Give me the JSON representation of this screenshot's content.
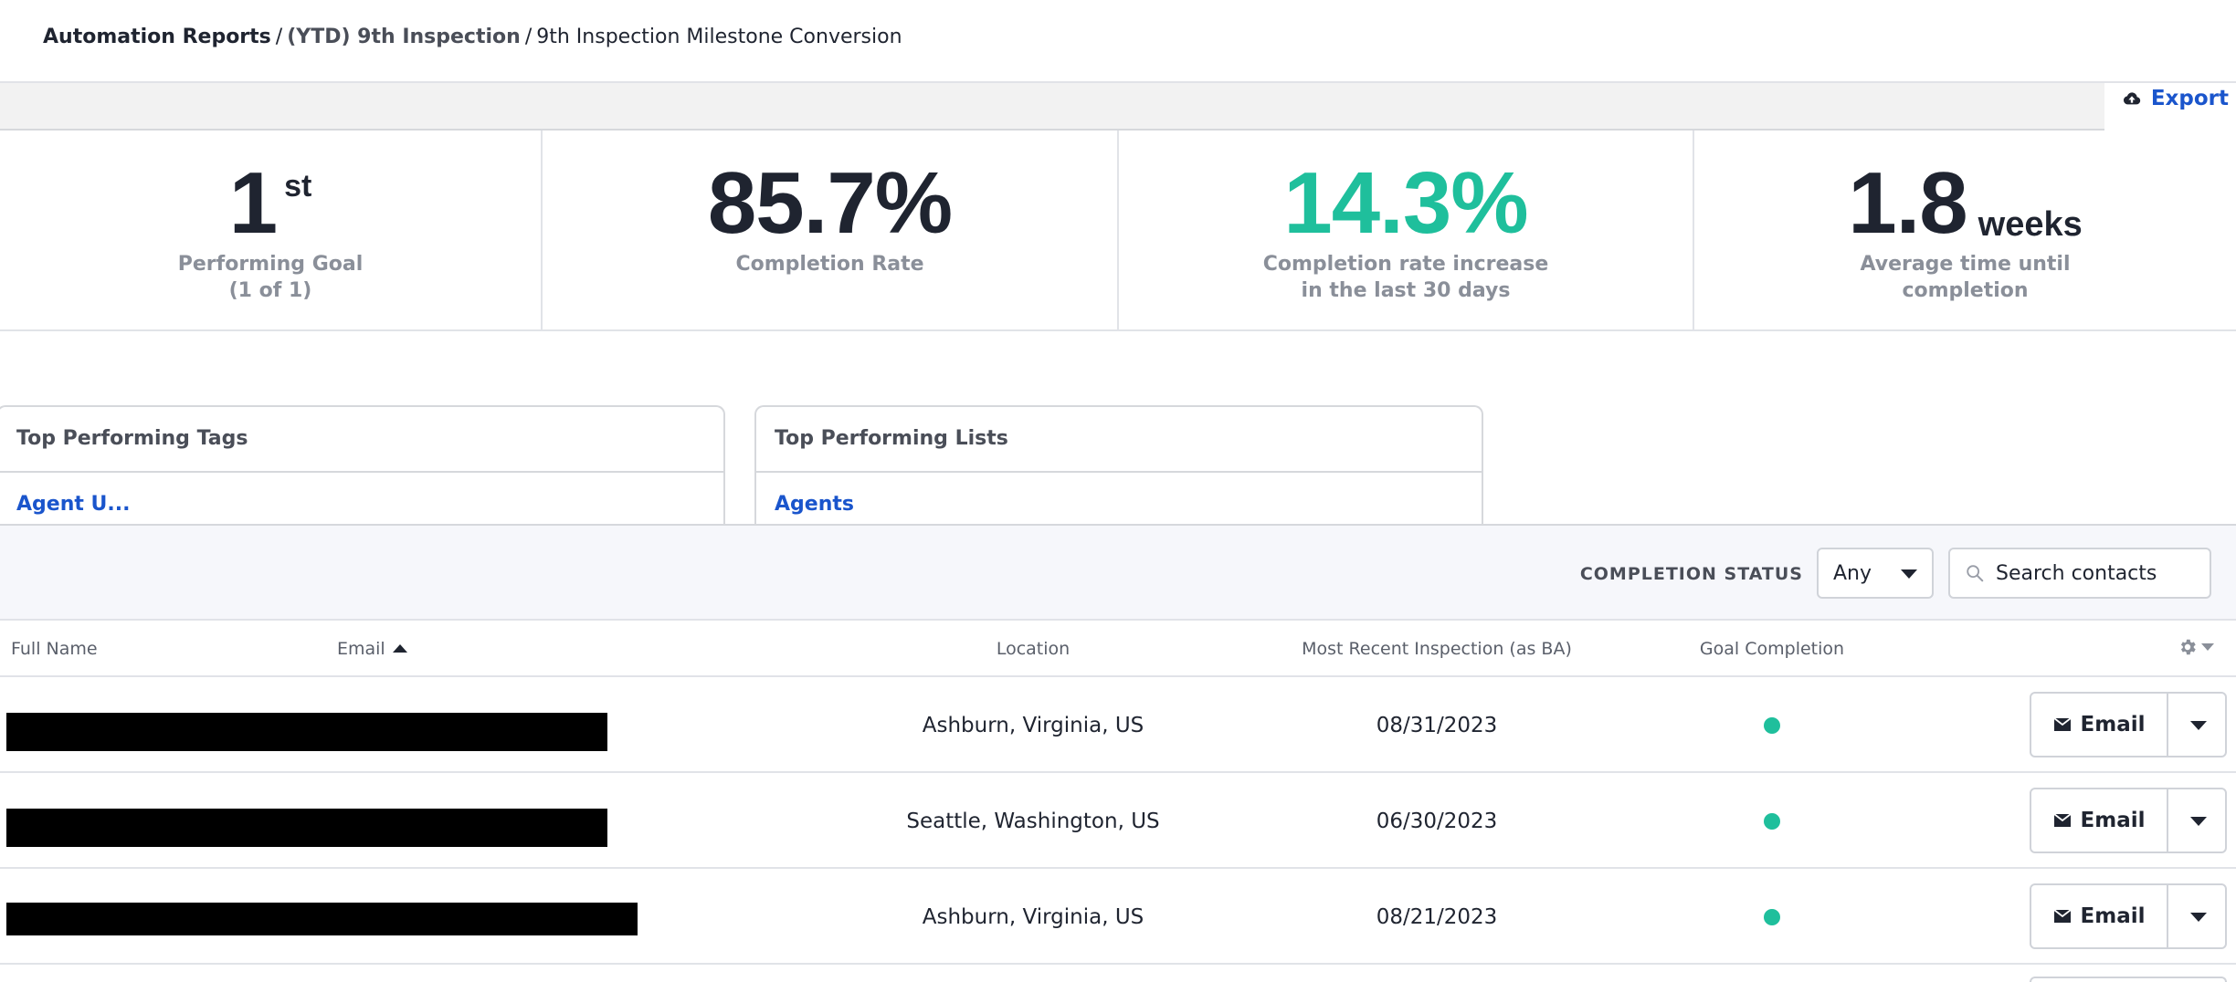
{
  "breadcrumb": {
    "root": "Automation Reports",
    "middle": "(YTD) 9th Inspection",
    "current": "9th Inspection Milestone Conversion",
    "separator": "/"
  },
  "toolbar": {
    "export_label": "Export",
    "export_icon": "cloud-upload-icon"
  },
  "stats": [
    {
      "value": "1",
      "sup": "st",
      "label_line1": "Performing Goal",
      "label_line2": "(1 of 1)"
    },
    {
      "value": "85.7%",
      "label_line1": "Completion Rate"
    },
    {
      "value": "14.3%",
      "label_line1": "Completion rate increase",
      "label_line2": "in the last 30 days",
      "color": "#1fbf9c"
    },
    {
      "value": "1.8",
      "unit": "weeks",
      "label_line1": "Average time until",
      "label_line2": "completion"
    }
  ],
  "cards": [
    {
      "title": "Top Performing Tags",
      "item": "Agent U..."
    },
    {
      "title": "Top Performing Lists",
      "item": "Agents"
    }
  ],
  "filter": {
    "label": "COMPLETION STATUS",
    "selected": "Any",
    "search_placeholder": "Search contacts",
    "search_icon": "magnifier-icon"
  },
  "table": {
    "columns": {
      "full_name": "Full Name",
      "email": "Email",
      "location": "Location",
      "inspection": "Most Recent Inspection (as BA)",
      "goal": "Goal Completion"
    },
    "sort": {
      "column": "Email",
      "direction": "ascending"
    },
    "settings_icon": "gear-icon",
    "rows": [
      {
        "location": "Ashburn, Virginia, US",
        "date": "08/31/2023",
        "goal_completed": true,
        "action": "Email"
      },
      {
        "location": "Seattle, Washington, US",
        "date": "06/30/2023",
        "goal_completed": true,
        "action": "Email"
      },
      {
        "location": "Ashburn, Virginia, US",
        "date": "08/21/2023",
        "goal_completed": true,
        "action": "Email"
      }
    ]
  },
  "colors": {
    "accent": "#1a55cc",
    "success": "#1fbf9c",
    "text": "#1f2430",
    "muted": "#8a8f99"
  }
}
